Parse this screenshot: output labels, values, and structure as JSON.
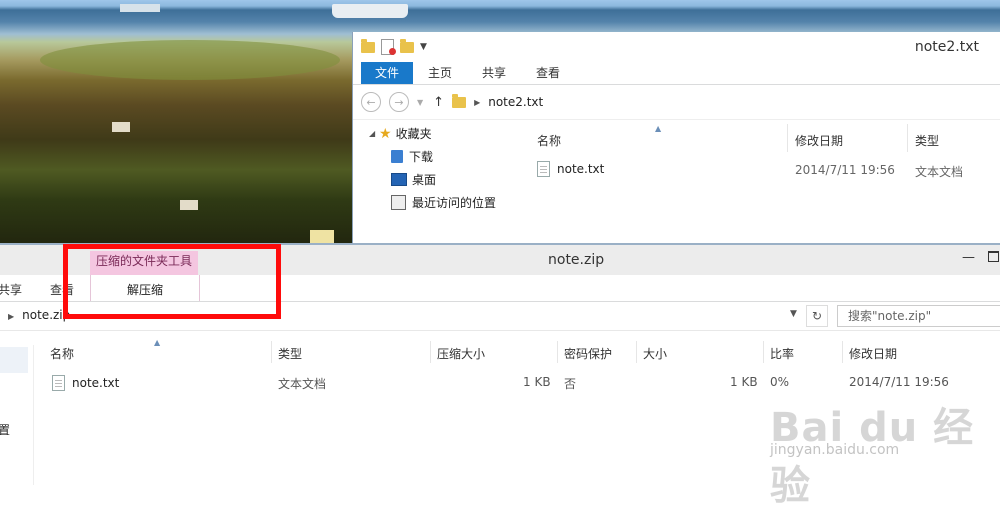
{
  "top_window": {
    "title": "note2.txt",
    "ribbon_tabs": [
      "文件",
      "主页",
      "共享",
      "查看"
    ],
    "address": "note2.txt",
    "nav": {
      "favorites": "收藏夹",
      "items": [
        "下载",
        "桌面",
        "最近访问的位置"
      ]
    },
    "columns": [
      "名称",
      "修改日期",
      "类型"
    ],
    "file": {
      "name": "note.txt",
      "date": "2014/7/11 19:56",
      "type": "文本文档"
    }
  },
  "bottom_window": {
    "title": "note.zip",
    "context_tab_group": "压缩的文件夹工具",
    "ribbon_tabs": [
      "共享",
      "查看"
    ],
    "context_tab": "解压缩",
    "address": "note.zip",
    "search_placeholder": "搜索\"note.zip\"",
    "left_pane_text": "置",
    "columns": [
      "名称",
      "类型",
      "压缩大小",
      "密码保护",
      "大小",
      "比率",
      "修改日期"
    ],
    "file": {
      "name": "note.txt",
      "type": "文本文档",
      "compressed_size": "1 KB",
      "password": "否",
      "size": "1 KB",
      "ratio": "0%",
      "date": "2014/7/11 19:56"
    }
  },
  "watermark": {
    "main": "Bai du 经验",
    "sub": "jingyan.baidu.com"
  },
  "colors": {
    "accent": "#1979ca",
    "highlight_box": "#ff0b0b",
    "context_tab": "#f4c6e0"
  }
}
